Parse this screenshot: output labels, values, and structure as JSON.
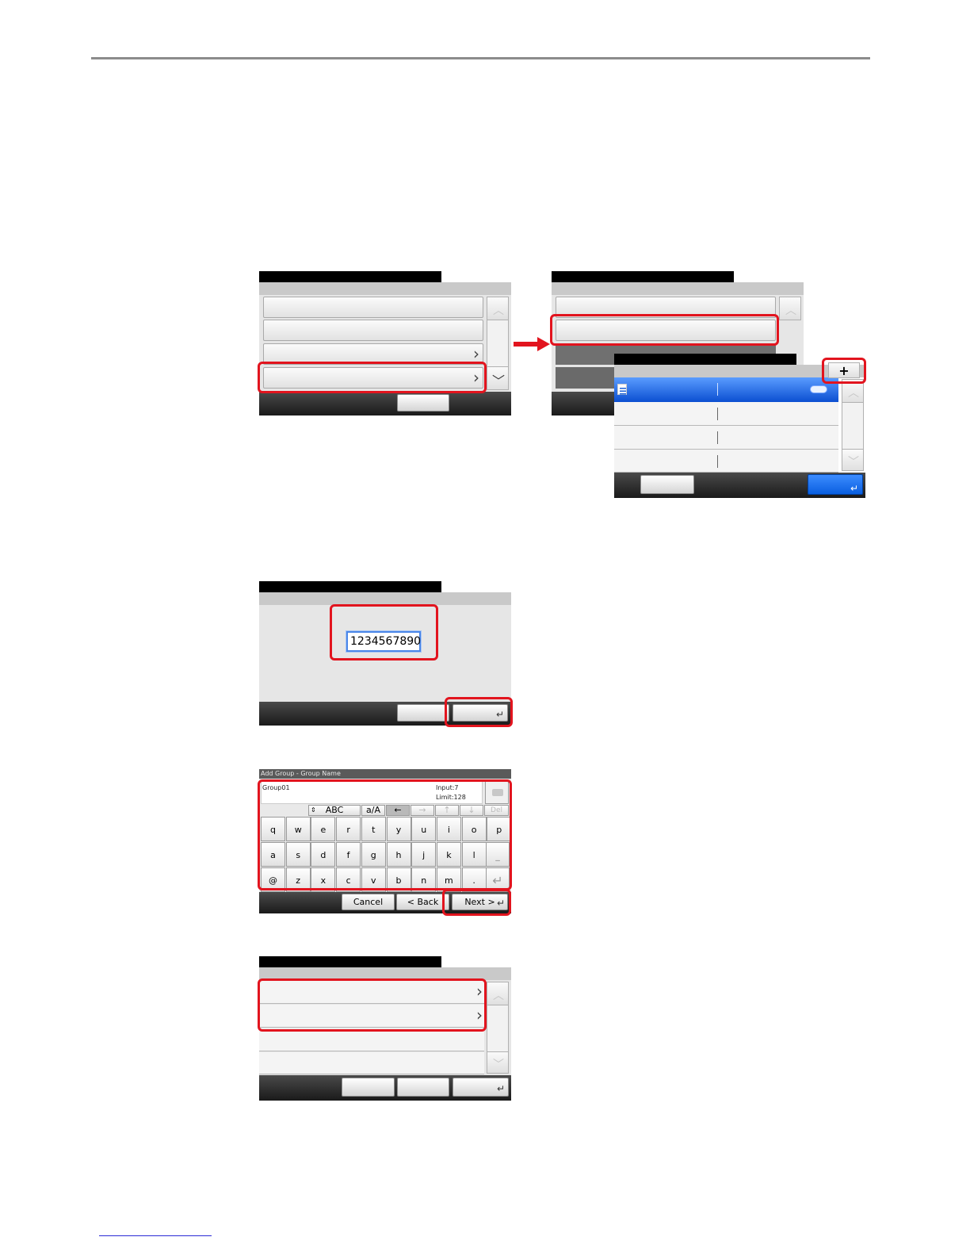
{
  "screen1": {
    "scroll_up_icon": "chevron-up-icon",
    "scroll_down_icon": "chevron-down-icon",
    "row_arrow_icon": "chevron-right-icon"
  },
  "screen2": {
    "popup_add_icon": "+",
    "list_icon": "list-icon",
    "enter_icon": "↵"
  },
  "screen3": {
    "input_value": "1234567890",
    "enter_icon": "↵"
  },
  "keyboard": {
    "title": "Add Group - Group Name",
    "value": "Group01",
    "input_count": "Input:7",
    "limit": "Limit:128",
    "backspace_icon": "backspace-icon",
    "mode_abc": "ABC",
    "mode_case": "a/A",
    "cursor_left": "←",
    "cursor_right": "→",
    "cursor_up": "↑",
    "cursor_down": "↓",
    "delete_label": "Del",
    "row1": [
      "q",
      "w",
      "e",
      "r",
      "t",
      "y",
      "u",
      "i",
      "o",
      "p"
    ],
    "row2": [
      "a",
      "s",
      "d",
      "f",
      "g",
      "h",
      "j",
      "k",
      "l"
    ],
    "row3": [
      "@",
      "z",
      "x",
      "c",
      "v",
      "b",
      "n",
      "m",
      "."
    ],
    "space_label": "_",
    "enter_icon": "↵",
    "cancel": "Cancel",
    "back": "< Back",
    "next": "Next >",
    "next_enter_icon": "↵"
  },
  "screen5": {
    "enter_icon": "↵"
  },
  "colors": {
    "highlight": "#e2141e",
    "selection": "#0b4fd1",
    "arrow": "#e2141e"
  }
}
